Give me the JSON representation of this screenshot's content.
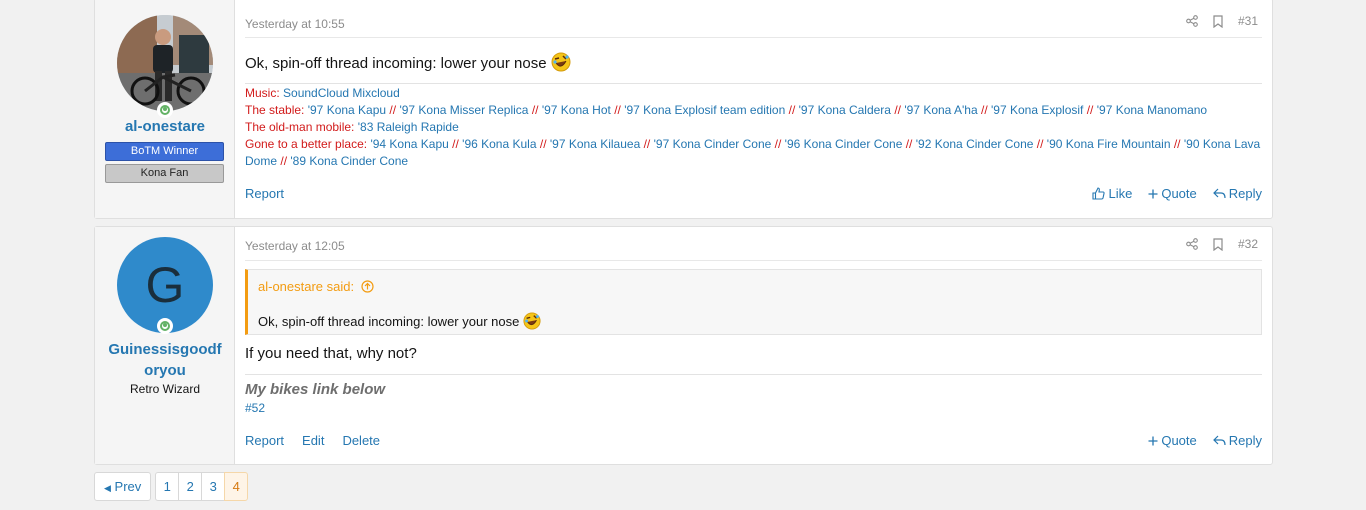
{
  "posts": [
    {
      "number": "#31",
      "date": "Yesterday at 10:55",
      "user": {
        "name": "al-onestare",
        "banners": [
          "BoTM Winner",
          "Kona Fan"
        ]
      },
      "message": "Ok, spin-off thread incoming: lower your nose",
      "signature": {
        "music_label": "Music:",
        "music_links": [
          "SoundCloud",
          "Mixcloud"
        ],
        "stable_label": "The stable:",
        "stable_items": [
          "'97 Kona Kapu",
          "'97 Kona Misser Replica",
          "'97 Kona Hot",
          "'97 Kona Explosif team edition",
          "'97 Kona Caldera",
          "'97 Kona A'ha",
          "'97 Kona Explosif",
          "'97 Kona Manomano"
        ],
        "oldman_label": "The old-man mobile:",
        "oldman_item": "'83 Raleigh Rapide",
        "gone_label": "Gone to a better place:",
        "gone_items": [
          "'94 Kona Kapu",
          "'96 Kona Kula",
          "'97 Kona Kilauea",
          "'97 Kona Cinder Cone",
          "'96 Kona Cinder Cone",
          "'92 Kona Cinder Cone",
          "'90 Kona Fire Mountain",
          "'90 Kona Lava Dome",
          "'89 Kona Cinder Cone"
        ],
        "separator": "//"
      },
      "actions": {
        "report": "Report",
        "like": "Like",
        "quote": "Quote",
        "reply": "Reply"
      }
    },
    {
      "number": "#32",
      "date": "Yesterday at 12:05",
      "user": {
        "name": "Guinessisgoodforyou",
        "name_line1": "Guinessisgoodf",
        "name_line2": "oryou",
        "avatar_letter": "G",
        "title": "Retro Wizard",
        "avatar_color": "#2f8acb"
      },
      "quote": {
        "author": "al-onestare said:",
        "text": "Ok, spin-off thread incoming: lower your nose"
      },
      "message": "If you need that, why not?",
      "signature": {
        "heading": "My bikes link below",
        "link": "#52"
      },
      "actions": {
        "report": "Report",
        "edit": "Edit",
        "delete": "Delete",
        "quote": "Quote",
        "reply": "Reply"
      }
    }
  ],
  "pagination": {
    "prev": "Prev",
    "pages": [
      "1",
      "2",
      "3",
      "4"
    ],
    "current": "4"
  },
  "colors": {
    "link": "#2577b1",
    "signature_label": "#d21b1b",
    "quote_accent": "#f39c12"
  }
}
